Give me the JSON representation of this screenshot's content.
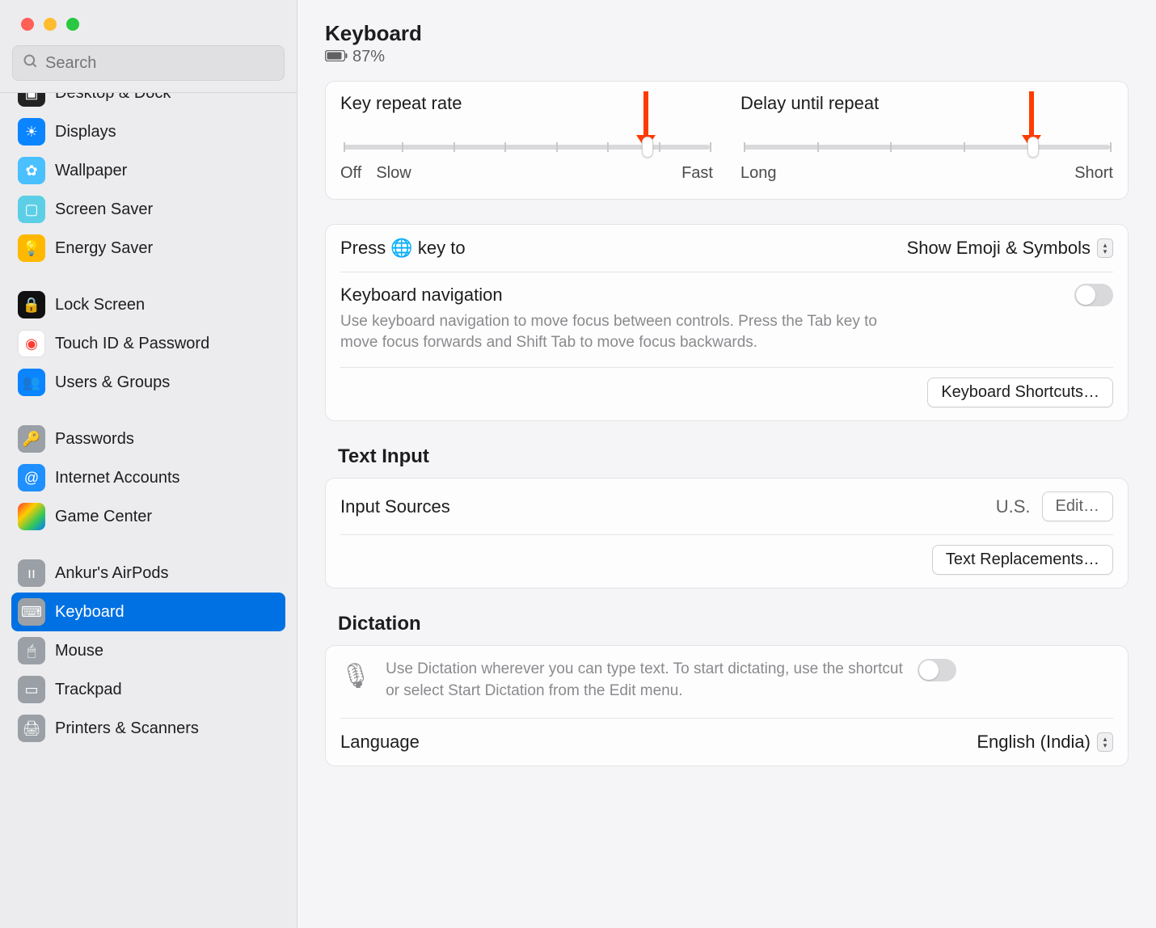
{
  "search": {
    "placeholder": "Search"
  },
  "sidebar": {
    "items": [
      {
        "label": "Desktop & Dock"
      },
      {
        "label": "Displays"
      },
      {
        "label": "Wallpaper"
      },
      {
        "label": "Screen Saver"
      },
      {
        "label": "Energy Saver"
      },
      {
        "label": "Lock Screen"
      },
      {
        "label": "Touch ID & Password"
      },
      {
        "label": "Users & Groups"
      },
      {
        "label": "Passwords"
      },
      {
        "label": "Internet Accounts"
      },
      {
        "label": "Game Center"
      },
      {
        "label": "Ankur's AirPods"
      },
      {
        "label": "Keyboard"
      },
      {
        "label": "Mouse"
      },
      {
        "label": "Trackpad"
      },
      {
        "label": "Printers & Scanners"
      }
    ]
  },
  "header": {
    "title": "Keyboard",
    "battery": "87%"
  },
  "sliders": {
    "repeat": {
      "title": "Key repeat rate",
      "off": "Off",
      "slow": "Slow",
      "fast": "Fast"
    },
    "delay": {
      "title": "Delay until repeat",
      "long": "Long",
      "short": "Short"
    }
  },
  "globe": {
    "label_prefix": "Press ",
    "label_suffix": " key to",
    "value": "Show Emoji & Symbols"
  },
  "kbnav": {
    "title": "Keyboard navigation",
    "desc": "Use keyboard navigation to move focus between controls. Press the Tab key to move focus forwards and Shift Tab to move focus backwards."
  },
  "buttons": {
    "kbshortcuts": "Keyboard Shortcuts…",
    "edit": "Edit…",
    "textrepl": "Text Replacements…"
  },
  "textinput": {
    "heading": "Text Input",
    "input_sources_label": "Input Sources",
    "input_sources_value": "U.S."
  },
  "dictation": {
    "heading": "Dictation",
    "desc": "Use Dictation wherever you can type text. To start dictating, use the shortcut or select Start Dictation from the Edit menu.",
    "language_label": "Language",
    "language_value": "English (India)"
  }
}
